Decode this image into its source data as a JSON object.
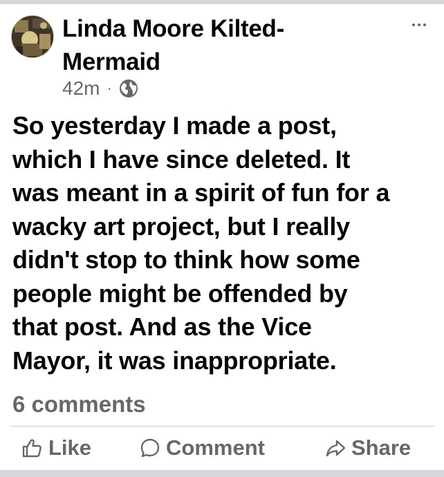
{
  "post": {
    "author": "Linda Moore Kilted-Mermaid",
    "time": "42m",
    "separator": "·",
    "audience_icon": "globe-icon",
    "text": "So yesterday I made a post,\nwhich I have since deleted. It\nwas meant in a spirit of fun for a\nwacky art project, but I really\ndidn't stop to think how some\npeople might be offended by\nthat post. And as the Vice\nMayor,  it was inappropriate.",
    "comments_count": "6 comments"
  },
  "actions": {
    "like": "Like",
    "comment": "Comment",
    "share": "Share"
  },
  "icons": {
    "more": "more-options-icon",
    "like": "thumbs-up-icon",
    "comment": "comment-bubble-icon",
    "share": "share-arrow-icon"
  },
  "colors": {
    "text": "#050505",
    "secondary": "#65676b",
    "divider": "#ced0d4"
  }
}
